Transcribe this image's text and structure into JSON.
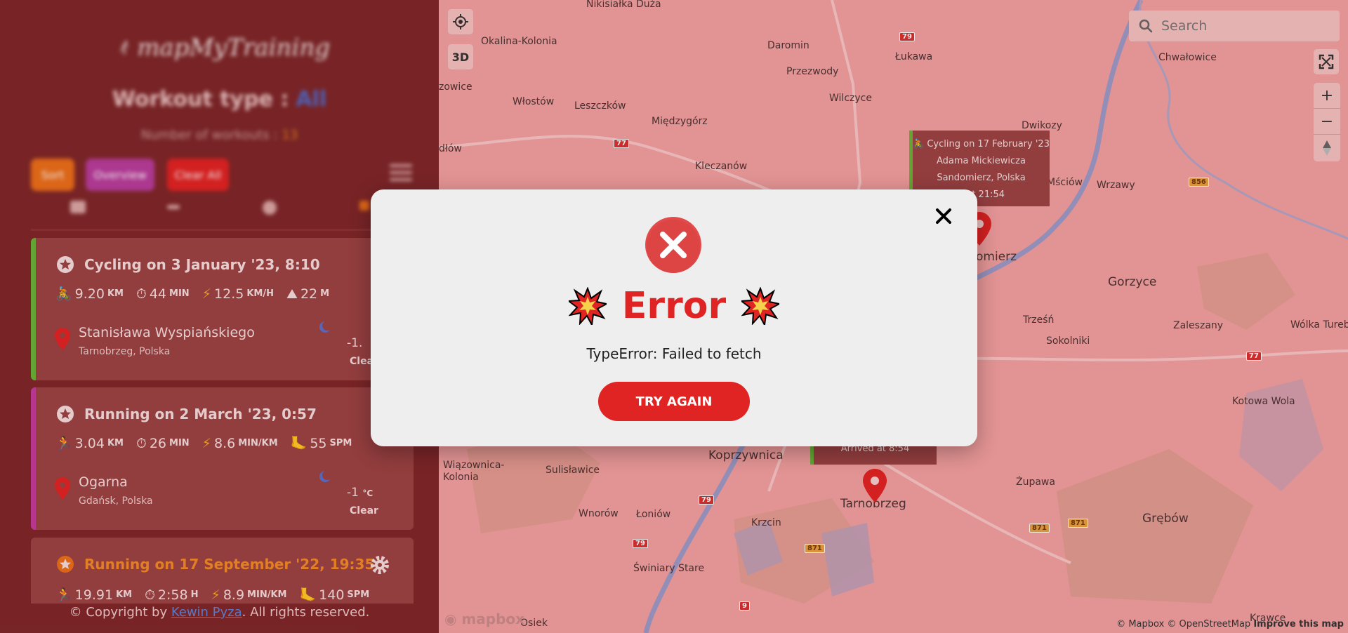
{
  "sidebar": {
    "logo_text": "mapMyTraining",
    "workout_type_label": "Workout type :",
    "workout_type_value": "All",
    "workout_count_label": "Number of workouts :",
    "workout_count_value": "13",
    "sort_label": "Sort",
    "overview_label": "Overview",
    "clear_all_label": "Clear All",
    "workouts": [
      {
        "title": "Cycling on 3 January '23, 8:10",
        "type": "cycling",
        "stripe_color": "#67b23a",
        "stats": [
          {
            "icon": "bike-icon",
            "value": "9.20",
            "unit": "KM"
          },
          {
            "icon": "stopwatch-icon",
            "value": "44",
            "unit": "MIN"
          },
          {
            "icon": "lightning-icon",
            "value": "12.5",
            "unit": "KM/H"
          },
          {
            "icon": "mountain-icon",
            "value": "22",
            "unit": "M"
          }
        ],
        "street": "Stanisława Wyspiańskiego",
        "city": "Tarnobrzeg, Polska",
        "temperature": "-1.",
        "sky": "Clear"
      },
      {
        "title": "Running on 2 March '23, 0:57",
        "type": "running",
        "stripe_color": "#c23b9d",
        "stats": [
          {
            "icon": "runner-icon",
            "value": "3.04",
            "unit": "KM"
          },
          {
            "icon": "stopwatch-icon",
            "value": "26",
            "unit": "MIN"
          },
          {
            "icon": "lightning-icon",
            "value": "8.6",
            "unit": "MIN/KM"
          },
          {
            "icon": "foot-icon",
            "value": "55",
            "unit": "SPM"
          }
        ],
        "street": "Ogarna",
        "city": "Gdańsk, Polska",
        "temperature": "-1",
        "temperature_unit": "°C",
        "sky": "Clear"
      },
      {
        "title": "Running on 17 September '22, 19:35",
        "type": "running",
        "stripe_color": "#c23b9d",
        "stats": [
          {
            "icon": "runner-icon",
            "value": "19.91",
            "unit": "KM"
          },
          {
            "icon": "stopwatch-icon",
            "value": "2:58",
            "unit": "H"
          },
          {
            "icon": "lightning-icon",
            "value": "8.9",
            "unit": "MIN/KM"
          },
          {
            "icon": "foot-icon",
            "value": "140",
            "unit": "SPM"
          }
        ]
      }
    ],
    "copyright_prefix": "© Copyright by ",
    "copyright_link": "Kewin Pyza",
    "copyright_suffix": ". All rights reserved."
  },
  "map": {
    "search_placeholder": "Search",
    "btn_3d": "3D",
    "zoom_in": "+",
    "zoom_out": "−",
    "places": [
      "Nikisiałka Duża",
      "Okalina-Kolonia",
      "Daromin",
      "Łukawa",
      "Chwałowice",
      "Przezwody",
      "zowice",
      "Włostów",
      "Leszczków",
      "Wilczyce",
      "Dwikozy",
      "Międzygórz",
      "dłów",
      "Kleczanów",
      "Mściów",
      "Wrzawy",
      "Gorzyce",
      "Trześń",
      "Sokolniki",
      "Zaleszany",
      "Wólka Turebska",
      "Kotowa Wola",
      "Koprzywnica",
      "Wiązownica-Kolonia",
      "Sulisławice",
      "Żupawa",
      "Wnorów",
      "Łoniów",
      "Krzcin",
      "Tarnobrzeg",
      "Grębów",
      "Świniary Stare",
      "Osiek",
      "Krawce",
      "omierz"
    ],
    "road_labels": [
      "79",
      "77",
      "856",
      "77",
      "79",
      "79",
      "871",
      "871",
      "871",
      "871",
      "9"
    ],
    "popup1": {
      "title": "Cycling on 17 February '23",
      "street": "Adama Mickiewicza",
      "city": "Sandomierz, Polska",
      "arrival": "d at 21:54"
    },
    "popup2": {
      "arrival": "Arrived at 8:54"
    },
    "mapbox_logo": "mapbox",
    "attribution": "© Mapbox © OpenStreetMap",
    "improve": "Improve this map"
  },
  "modal": {
    "title": "Error",
    "message": "TypeError: Failed to fetch",
    "button_label": "TRY AGAIN"
  },
  "colors": {
    "error_red": "#e02323",
    "sort_orange": "#e96f1a",
    "overview_purple": "#b63d9d",
    "cycling_green": "#67b23a",
    "running_pink": "#c23b9d"
  }
}
